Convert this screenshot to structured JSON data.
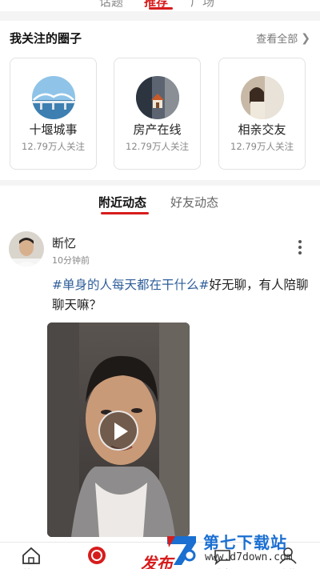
{
  "top_tabs": [
    {
      "label": "话题"
    },
    {
      "label": "推荐"
    },
    {
      "label": "广场"
    }
  ],
  "circles_section": {
    "title": "我关注的圈子",
    "view_all": "查看全部",
    "items": [
      {
        "name": "十堰城事",
        "followers": "12.79万人关注"
      },
      {
        "name": "房产在线",
        "followers": "12.79万人关注"
      },
      {
        "name": "相亲交友",
        "followers": "12.79万人关注"
      }
    ]
  },
  "feed_tabs": {
    "active": "附近动态",
    "inactive": "好友动态"
  },
  "post": {
    "username": "断忆",
    "time": "10分钟前",
    "tag": "#单身的人每天都在干什么#",
    "body": "好无聊，有人陪聊聊天嘛？"
  },
  "bottom_nav": {
    "home": "首页",
    "circle": "圈子",
    "publish": "发布",
    "message": "消息",
    "me": "我的"
  },
  "watermark": {
    "name": "第七下载站",
    "url": "www.d7down.com"
  },
  "colors": {
    "accent": "#d71c1c",
    "tag": "#2e5e9a",
    "watermark": "#1a6fd1"
  }
}
